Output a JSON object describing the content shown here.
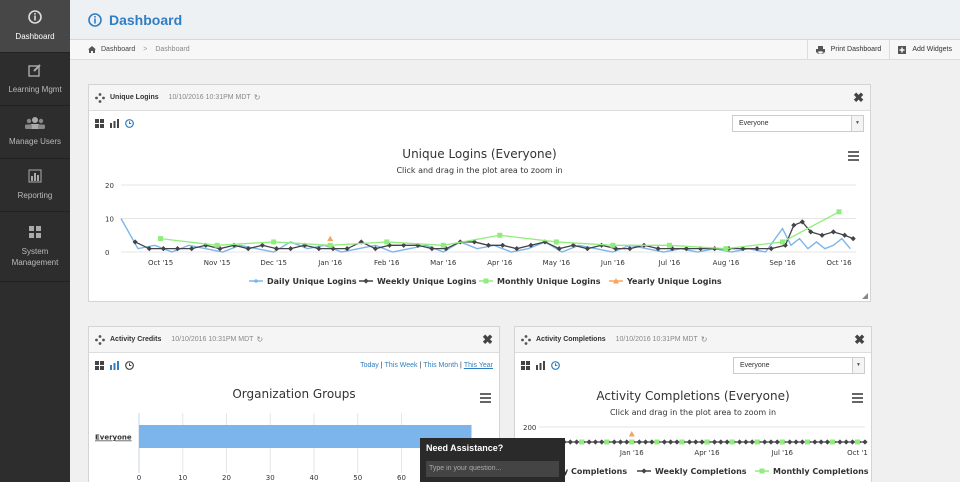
{
  "sidebar": {
    "items": [
      {
        "label": "Dashboard",
        "icon": "info-icon",
        "active": true
      },
      {
        "label": "Learning Mgmt",
        "icon": "edit-icon"
      },
      {
        "label": "Manage Users",
        "icon": "users-icon"
      },
      {
        "label": "Reporting",
        "icon": "chart-icon"
      },
      {
        "label": "System Management",
        "icon": "grid-icon"
      }
    ]
  },
  "header": {
    "title": "Dashboard",
    "icon": "info-icon"
  },
  "breadcrumb": {
    "home": "Dashboard",
    "current": "Dashboard"
  },
  "toolbar": {
    "print_label": "Print Dashboard",
    "add_label": "Add Widgets"
  },
  "widgets": {
    "unique_logins": {
      "title": "Unique Logins",
      "timestamp": "10/10/2016 10:31PM MDT",
      "filter": "Everyone",
      "chart_title": "Unique Logins (Everyone)",
      "chart_subtitle": "Click and drag in the plot area to zoom in"
    },
    "activity_credits": {
      "title": "Activity Credits",
      "timestamp": "10/10/2016 10:31PM MDT",
      "links": {
        "today": "Today",
        "week": "This Week",
        "month": "This Month",
        "year": "This Year"
      },
      "chart_title": "Organization Groups"
    },
    "activity_completions": {
      "title": "Activity Completions",
      "timestamp": "10/10/2016 10:31PM MDT",
      "filter": "Everyone",
      "chart_title": "Activity Completions (Everyone)",
      "chart_subtitle": "Click and drag in the plot area to zoom in"
    }
  },
  "assist": {
    "title": "Need Assistance?",
    "placeholder": "Type in your question..."
  },
  "colors": {
    "accent": "#2f7ec4",
    "daily": "#7cb5ec",
    "weekly": "#434348",
    "monthly": "#90ed7d",
    "yearly": "#f7a35c"
  },
  "chart_data": [
    {
      "type": "line",
      "title": "Unique Logins (Everyone)",
      "subtitle": "Click and drag in the plot area to zoom in",
      "ylim": [
        0,
        20
      ],
      "yticks": [
        0,
        10,
        20
      ],
      "xlim": [
        0,
        13
      ],
      "xticks": [
        {
          "x": 0.7,
          "label": "Oct '15"
        },
        {
          "x": 1.7,
          "label": "Nov '15"
        },
        {
          "x": 2.7,
          "label": "Dec '15"
        },
        {
          "x": 3.7,
          "label": "Jan '16"
        },
        {
          "x": 4.7,
          "label": "Feb '16"
        },
        {
          "x": 5.7,
          "label": "Mar '16"
        },
        {
          "x": 6.7,
          "label": "Apr '16"
        },
        {
          "x": 7.7,
          "label": "May '16"
        },
        {
          "x": 8.7,
          "label": "Jun '16"
        },
        {
          "x": 9.7,
          "label": "Jul '16"
        },
        {
          "x": 10.7,
          "label": "Aug '16"
        },
        {
          "x": 11.7,
          "label": "Sep '16"
        },
        {
          "x": 12.7,
          "label": "Oct '16"
        }
      ],
      "legend_position": "bottom",
      "series": [
        {
          "name": "Daily Unique Logins",
          "color": "#7cb5ec",
          "marker": "circle",
          "x": [
            0,
            0.3,
            0.6,
            0.9,
            1.2,
            1.5,
            1.8,
            2.1,
            2.4,
            2.7,
            3.0,
            3.3,
            3.6,
            3.9,
            4.2,
            4.5,
            4.8,
            5.1,
            5.4,
            5.7,
            6.0,
            6.3,
            6.6,
            6.9,
            7.2,
            7.5,
            7.8,
            8.1,
            8.4,
            8.7,
            9.0,
            9.3,
            9.6,
            9.9,
            10.2,
            10.5,
            10.8,
            11.1,
            11.4,
            11.7,
            11.85,
            12.0,
            12.15,
            12.3,
            12.45,
            12.6,
            12.75,
            12.9
          ],
          "y": [
            10,
            1,
            2,
            0,
            2,
            1,
            0,
            2,
            1,
            0,
            3,
            1,
            2,
            0,
            1,
            2,
            0,
            1,
            2,
            0,
            3,
            1,
            2,
            0,
            1,
            3,
            0,
            2,
            1,
            0,
            2,
            1,
            0,
            1,
            0,
            1,
            0,
            1,
            0,
            7,
            2,
            4,
            1,
            3,
            1,
            2,
            4,
            1
          ]
        },
        {
          "name": "Weekly Unique Logins",
          "color": "#434348",
          "marker": "diamond",
          "x": [
            0.25,
            0.5,
            0.75,
            1.0,
            1.25,
            1.5,
            1.75,
            2.0,
            2.25,
            2.5,
            2.75,
            3.0,
            3.25,
            3.5,
            3.75,
            4.0,
            4.25,
            4.5,
            4.75,
            5.0,
            5.25,
            5.5,
            5.75,
            6.0,
            6.25,
            6.5,
            6.75,
            7.0,
            7.25,
            7.5,
            7.75,
            8.0,
            8.25,
            8.5,
            8.75,
            9.0,
            9.25,
            9.5,
            9.75,
            10.0,
            10.25,
            10.5,
            10.75,
            11.0,
            11.25,
            11.5,
            11.75,
            11.9,
            12.05,
            12.2,
            12.4,
            12.6,
            12.8,
            12.95
          ],
          "y": [
            3,
            1,
            1,
            1,
            1,
            2,
            1,
            2,
            1,
            2,
            1,
            1,
            2,
            1,
            1,
            1,
            3,
            1,
            2,
            2,
            2,
            1,
            1,
            3,
            3,
            2,
            2,
            1,
            2,
            3,
            1,
            2,
            1,
            2,
            1,
            1,
            2,
            1,
            1,
            1,
            1,
            1,
            1,
            1,
            1,
            1,
            2,
            8,
            9,
            6,
            5,
            6,
            5,
            4
          ]
        },
        {
          "name": "Monthly Unique Logins",
          "color": "#90ed7d",
          "marker": "square",
          "x": [
            0.7,
            1.7,
            2.7,
            3.7,
            4.7,
            5.7,
            6.7,
            7.7,
            8.7,
            9.7,
            10.7,
            11.7,
            12.7
          ],
          "y": [
            4,
            2,
            3,
            2,
            3,
            2,
            5,
            3,
            2,
            2,
            1,
            3,
            12
          ]
        },
        {
          "name": "Yearly Unique Logins",
          "color": "#f7a35c",
          "marker": "triangle",
          "x": [
            3.7
          ],
          "y": [
            4
          ]
        }
      ]
    },
    {
      "type": "bar",
      "title": "Organization Groups",
      "categories": [
        "Everyone"
      ],
      "values": [
        76
      ],
      "xlim": [
        0,
        80
      ],
      "xticks": [
        0,
        10,
        20,
        30,
        40,
        50,
        60
      ]
    },
    {
      "type": "line",
      "title": "Activity Completions (Everyone)",
      "subtitle": "Click and drag in the plot area to zoom in",
      "ylim": [
        0,
        200
      ],
      "yticks": [
        200
      ],
      "xlim": [
        0,
        13
      ],
      "xticks": [
        {
          "x": 0.15,
          "label": "15"
        },
        {
          "x": 3.7,
          "label": "Jan '16"
        },
        {
          "x": 6.7,
          "label": "Apr '16"
        },
        {
          "x": 9.7,
          "label": "Jul '16"
        },
        {
          "x": 12.7,
          "label": "Oct '1"
        }
      ],
      "legend_position": "bottom",
      "series": [
        {
          "name": "Daily Completions",
          "color": "#7cb5ec",
          "legend_text": "y Completions"
        },
        {
          "name": "Weekly Completions",
          "color": "#434348",
          "legend_text": "Weekly Completions"
        },
        {
          "name": "Monthly Completions",
          "color": "#90ed7d",
          "legend_text": "Monthly Completions"
        }
      ]
    }
  ]
}
